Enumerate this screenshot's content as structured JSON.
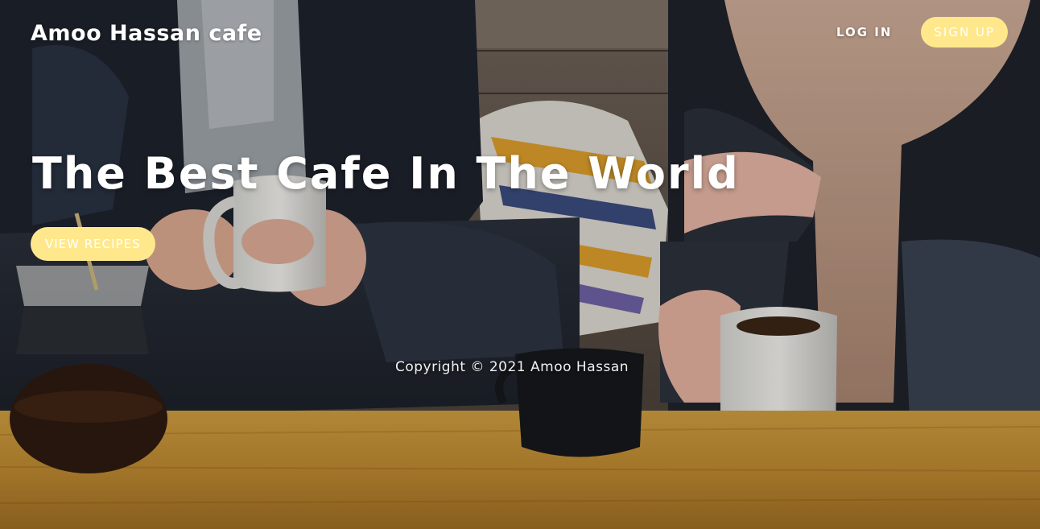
{
  "brand": {
    "name": "Amoo Hassan cafe"
  },
  "nav": {
    "login_label": "LOG IN",
    "signup_label": "SIGN UP"
  },
  "hero": {
    "headline": "The Best Cafe In The World",
    "cta_label": "VIEW RECIPES",
    "background_description": "background-photo"
  },
  "footer": {
    "copyright": "Copyright © 2021 Amoo Hassan"
  },
  "colors": {
    "accent": "#ffe88c",
    "text_on_photo": "#ffffff"
  }
}
